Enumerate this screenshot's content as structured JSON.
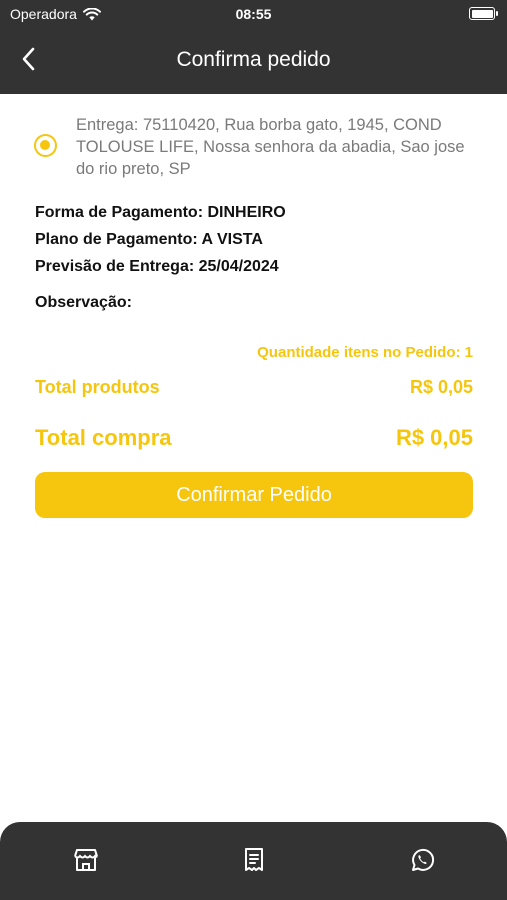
{
  "status_bar": {
    "carrier": "Operadora",
    "time": "08:55"
  },
  "nav": {
    "title": "Confirma pedido"
  },
  "address": {
    "text": "Entrega: 75110420, Rua borba gato, 1945, COND TOLOUSE LIFE, Nossa senhora da abadia, Sao jose do rio preto, SP",
    "selected": true
  },
  "order": {
    "payment_form": "Forma de Pagamento: DINHEIRO",
    "payment_plan": "Plano de Pagamento: A VISTA",
    "delivery_forecast": "Previsão de Entrega: 25/04/2024",
    "observation_label": "Observação:"
  },
  "summary": {
    "quantity": "Quantidade itens no Pedido: 1",
    "total_products_label": "Total produtos",
    "total_products_value": "R$ 0,05",
    "total_purchase_label": "Total compra",
    "total_purchase_value": "R$ 0,05"
  },
  "confirm_button": "Confirmar Pedido",
  "tab_bar": {
    "icons": [
      "store-icon",
      "receipt-icon",
      "whatsapp-icon"
    ]
  },
  "colors": {
    "accent": "#f5c60d",
    "dark": "#333333",
    "muted_text": "#7a7a7a"
  }
}
